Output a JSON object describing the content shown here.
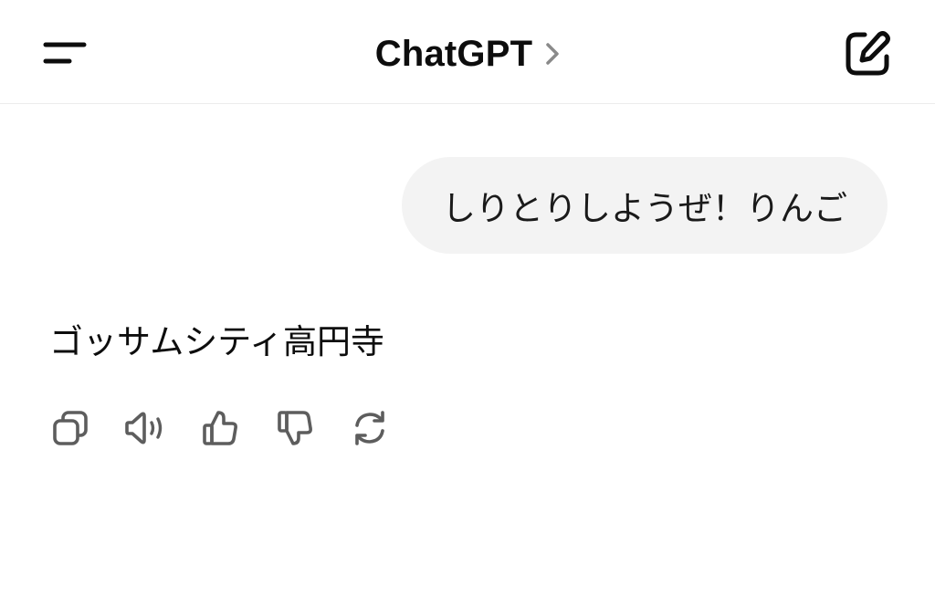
{
  "header": {
    "title": "ChatGPT",
    "icons": {
      "menu": "menu-icon",
      "title_chevron": "chevron-right-icon",
      "new_chat": "compose-icon"
    }
  },
  "conversation": {
    "user_message": "しりとりしようぜ！りんご",
    "assistant_message": "ゴッサムシティ高円寺"
  },
  "message_actions": [
    {
      "name": "copy",
      "icon": "copy-icon"
    },
    {
      "name": "read-aloud",
      "icon": "speaker-icon"
    },
    {
      "name": "good-response",
      "icon": "thumbs-up-icon"
    },
    {
      "name": "bad-response",
      "icon": "thumbs-down-icon"
    },
    {
      "name": "regenerate",
      "icon": "refresh-icon"
    }
  ],
  "colors": {
    "background": "#ffffff",
    "user_bubble": "#f3f3f3",
    "text": "#0d0d0d",
    "icon": "#5d5d5d",
    "divider": "#ececec"
  }
}
